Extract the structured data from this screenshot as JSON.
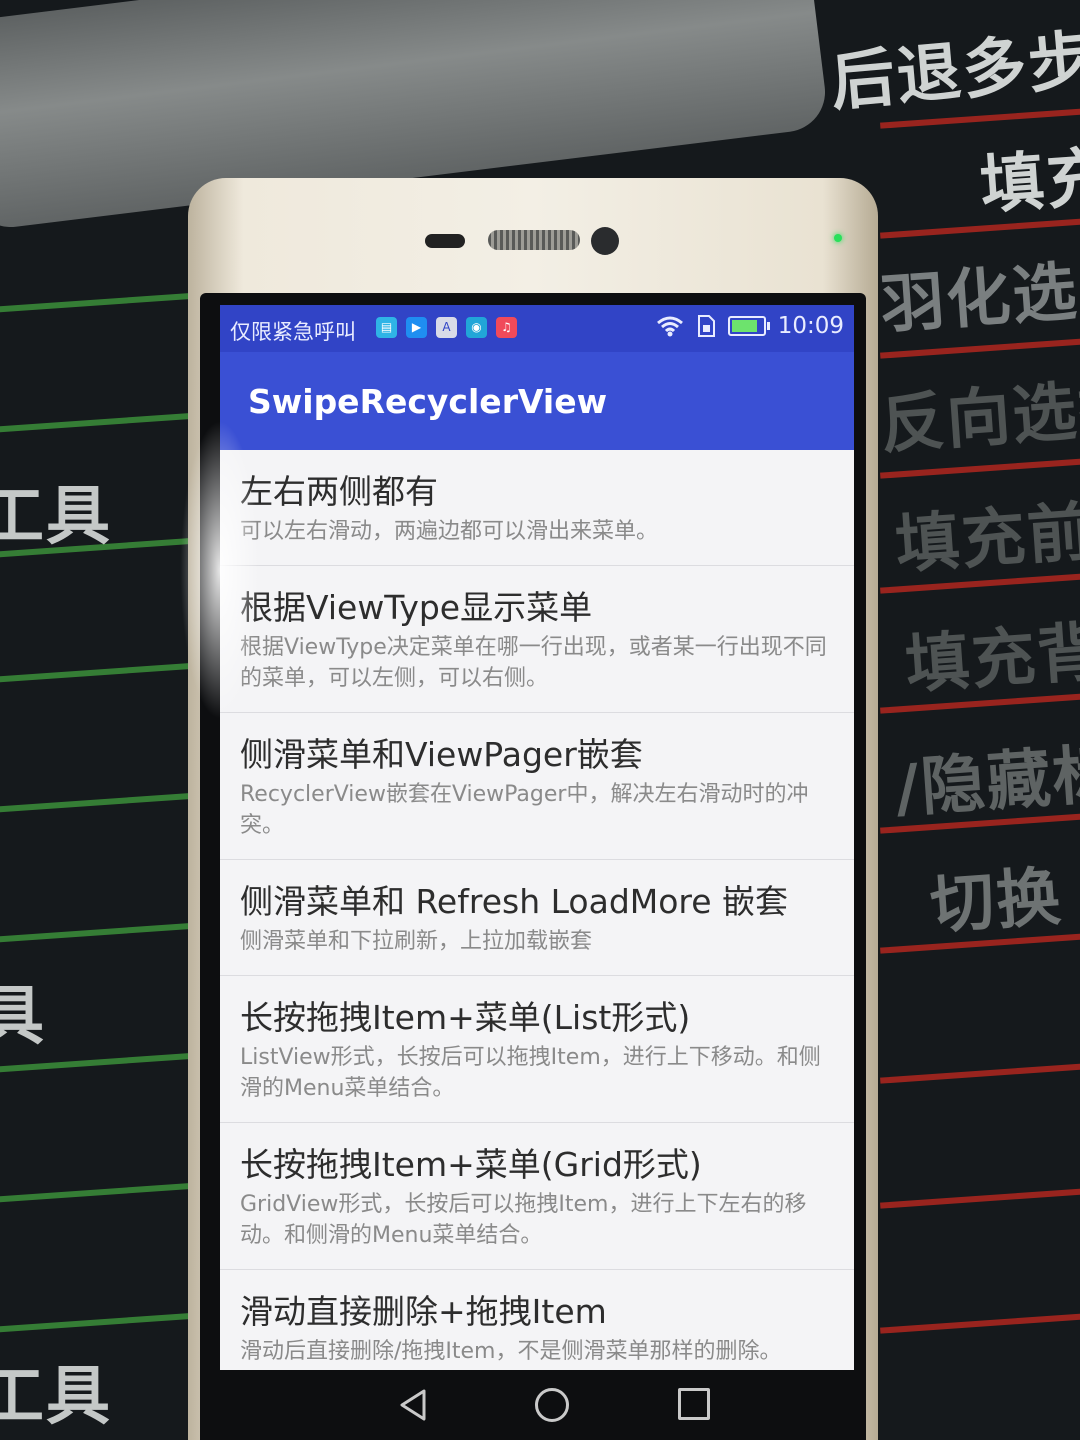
{
  "background": {
    "menu_items": [
      "后退多步",
      "填充",
      "羽化选区",
      "反向选择",
      "填充前景",
      "填充背景",
      "/隐藏标",
      "切换"
    ],
    "left_fragments": [
      "工具",
      "具",
      "工具"
    ]
  },
  "status_bar": {
    "carrier_text": "仅限紧急呼叫",
    "time": "10:09"
  },
  "app_bar": {
    "title": "SwipeRecyclerView"
  },
  "list": [
    {
      "title": "左右两侧都有",
      "description": "可以左右滑动，两遍边都可以滑出来菜单。"
    },
    {
      "title": "根据ViewType显示菜单",
      "description": "根据ViewType决定菜单在哪一行出现，或者某一行出现不同的菜单，可以左侧，可以右侧。"
    },
    {
      "title": "侧滑菜单和ViewPager嵌套",
      "description": "RecyclerView嵌套在ViewPager中，解决左右滑动时的冲突。"
    },
    {
      "title": "侧滑菜单和 Refresh LoadMore 嵌套",
      "description": "侧滑菜单和下拉刷新，上拉加载嵌套"
    },
    {
      "title": "长按拖拽Item+菜单(List形式)",
      "description": "ListView形式，长按后可以拖拽Item，进行上下移动。和侧滑的Menu菜单结合。"
    },
    {
      "title": "长按拖拽Item+菜单(Grid形式)",
      "description": "GridView形式，长按后可以拖拽Item，进行上下左右的移动。和侧滑的Menu菜单结合。"
    },
    {
      "title": "滑动直接删除+拖拽Item",
      "description": "滑动后直接删除/拖拽Item，不是侧滑菜单那样的删除。"
    }
  ],
  "colors": {
    "status_bar": "#3144c6",
    "app_bar": "#3a50d4",
    "list_background": "#f4f4f6"
  }
}
